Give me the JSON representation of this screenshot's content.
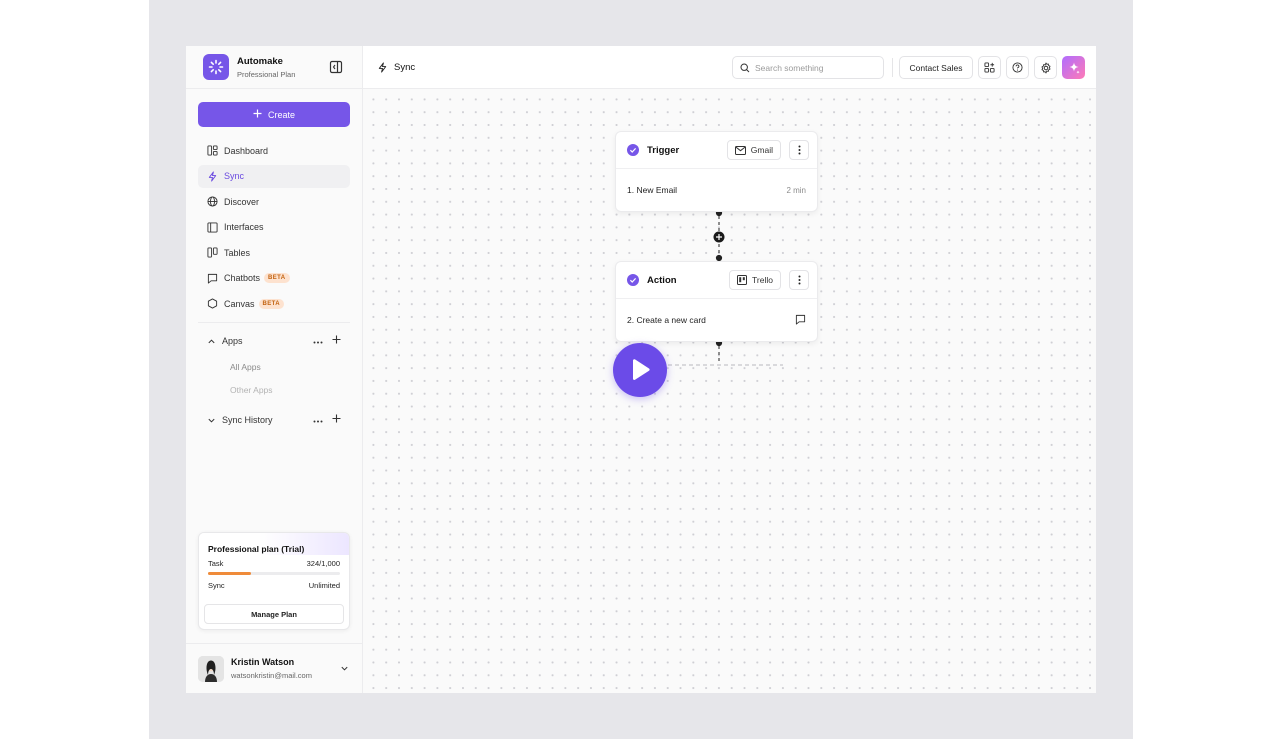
{
  "brand": {
    "name": "Automake",
    "plan": "Professional Plan"
  },
  "sidebar": {
    "create_label": "Create",
    "nav": [
      {
        "label": "Dashboard",
        "icon": "dashboard-icon"
      },
      {
        "label": "Sync",
        "icon": "lightning-icon",
        "active": true
      },
      {
        "label": "Discover",
        "icon": "globe-icon"
      },
      {
        "label": "Interfaces",
        "icon": "interfaces-icon"
      },
      {
        "label": "Tables",
        "icon": "tables-icon"
      },
      {
        "label": "Chatbots",
        "icon": "chat-icon",
        "badge": "BETA"
      },
      {
        "label": "Canvas",
        "icon": "hexagon-icon",
        "badge": "BETA"
      }
    ],
    "apps": {
      "label": "Apps",
      "items": [
        "All Apps",
        "Other Apps"
      ]
    },
    "sync_history": {
      "label": "Sync History"
    }
  },
  "plan_card": {
    "title": "Professional plan (Trial)",
    "task_label": "Task",
    "task_value": "324/1,000",
    "task_fraction": 0.324,
    "sync_label": "Sync",
    "sync_value": "Unlimited",
    "manage_label": "Manage Plan"
  },
  "user": {
    "name": "Kristin Watson",
    "email": "watsonkristin@mail.com"
  },
  "header": {
    "crumb": "Sync",
    "search_placeholder": "Search something",
    "contact_label": "Contact Sales"
  },
  "flow": {
    "trigger": {
      "title": "Trigger",
      "app": "Gmail",
      "step": "1. New Email",
      "meta": "2 min"
    },
    "action": {
      "title": "Action",
      "app": "Trello",
      "step": "2. Create a new card"
    }
  },
  "colors": {
    "accent": "#7656e8",
    "badge_bg": "#fde2cf",
    "badge_text": "#c2620f",
    "progress": "#ef8b3a"
  }
}
